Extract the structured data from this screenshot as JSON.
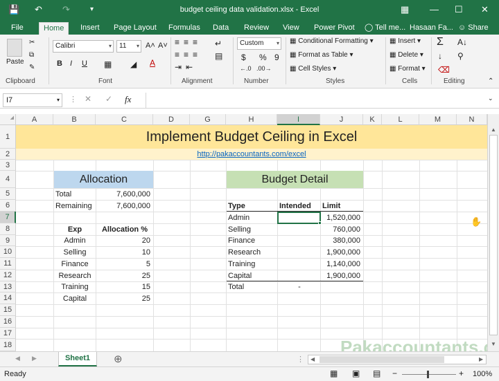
{
  "window": {
    "title": "budget ceiling data validation.xlsx - Excel"
  },
  "tabs": [
    "File",
    "Home",
    "Insert",
    "Page Layout",
    "Formulas",
    "Data",
    "Review",
    "View",
    "Power Pivot"
  ],
  "tell_me": "Tell me...",
  "user": "Hasaan Fa...",
  "share": "Share",
  "ribbon": {
    "clipboard": {
      "label": "Clipboard",
      "paste": "Paste"
    },
    "font": {
      "label": "Font",
      "name": "Calibri",
      "size": "11",
      "bold": "B",
      "italic": "I",
      "underline": "U"
    },
    "alignment": {
      "label": "Alignment"
    },
    "number": {
      "label": "Number",
      "format": "Custom",
      "currency": "$",
      "percent": "%",
      "comma": "9"
    },
    "styles": {
      "label": "Styles",
      "conditional": "Conditional Formatting",
      "table": "Format as Table",
      "cell_styles": "Cell Styles"
    },
    "cells": {
      "label": "Cells",
      "insert": "Insert",
      "delete": "Delete",
      "format": "Format"
    },
    "editing": {
      "label": "Editing"
    }
  },
  "formula_bar": {
    "name_box": "I7",
    "fx": "fx",
    "value": ""
  },
  "columns": [
    "A",
    "B",
    "C",
    "D",
    "G",
    "H",
    "I",
    "J",
    "K",
    "L",
    "M",
    "N"
  ],
  "rows": [
    "1",
    "2",
    "3",
    "4",
    "5",
    "6",
    "7",
    "8",
    "9",
    "10",
    "11",
    "12",
    "13",
    "14",
    "15",
    "16",
    "17",
    "18"
  ],
  "sheet": {
    "title": "Implement Budget Ceiling in Excel",
    "url": "http://pakaccountants.com/excel",
    "allocation": {
      "header": "Allocation",
      "total_label": "Total",
      "total_value": "7,600,000",
      "remaining_label": "Remaining",
      "remaining_value": "7,600,000",
      "col_exp": "Exp",
      "col_pct": "Allocation %",
      "rows": [
        {
          "exp": "Admin",
          "pct": "20"
        },
        {
          "exp": "Selling",
          "pct": "10"
        },
        {
          "exp": "Finance",
          "pct": "5"
        },
        {
          "exp": "Research",
          "pct": "25"
        },
        {
          "exp": "Training",
          "pct": "15"
        },
        {
          "exp": "Capital",
          "pct": "25"
        }
      ]
    },
    "budget": {
      "header": "Budget Detail",
      "col_type": "Type",
      "col_intended": "Intended",
      "col_limit": "Limit",
      "rows": [
        {
          "type": "Admin",
          "intended": "",
          "limit": "1,520,000"
        },
        {
          "type": "Selling",
          "intended": "",
          "limit": "760,000"
        },
        {
          "type": "Finance",
          "intended": "",
          "limit": "380,000"
        },
        {
          "type": "Research",
          "intended": "",
          "limit": "1,900,000"
        },
        {
          "type": "Training",
          "intended": "",
          "limit": "1,140,000"
        },
        {
          "type": "Capital",
          "intended": "",
          "limit": "1,900,000"
        }
      ],
      "total_label": "Total",
      "total_value": "-"
    }
  },
  "sheet_tab": "Sheet1",
  "status": {
    "ready": "Ready",
    "zoom": "100%"
  },
  "watermark": "Pakaccountants.com",
  "colors": {
    "excel_green": "#217346",
    "title_band": "#ffe699",
    "allocation_header": "#bdd7ee",
    "budget_header": "#c6e0b4"
  }
}
